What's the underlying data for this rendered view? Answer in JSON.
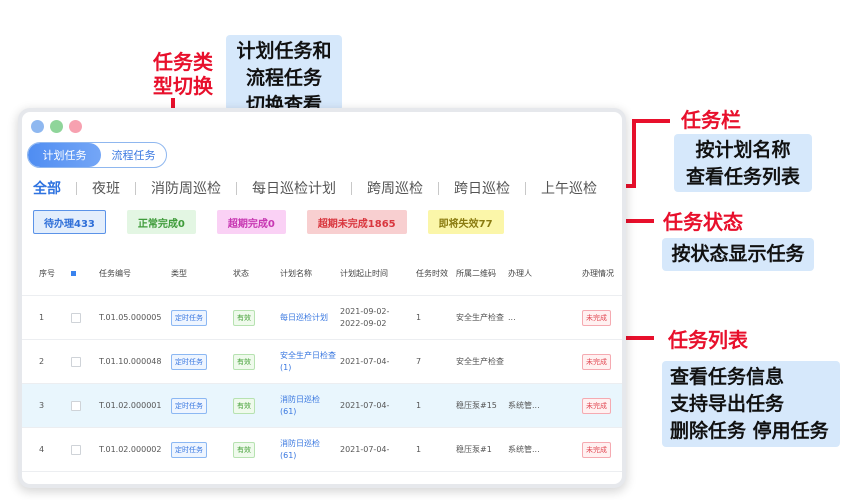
{
  "annotations": {
    "task_type": {
      "title": "任务类型切换",
      "note_lines": [
        "计划任务和",
        "流程任务",
        "切换查看"
      ]
    },
    "task_bar": {
      "title": "任务栏",
      "note_lines": [
        "按计划名称",
        "查看任务列表"
      ]
    },
    "task_status": {
      "title": "任务状态",
      "note_lines": [
        "按状态显示任务"
      ]
    },
    "task_list": {
      "title": "任务列表",
      "note_lines": [
        "查看任务信息",
        "支持导出任务",
        "删除任务 停用任务"
      ]
    }
  },
  "window": {
    "dot_colors": [
      "#8fb8f0",
      "#8fd59a",
      "#f7a1b0"
    ],
    "segment": {
      "active": "计划任务",
      "inactive": "流程任务"
    },
    "plan_tabs": [
      "全部",
      "夜班",
      "消防周巡检",
      "每日巡检计划",
      "跨周巡检",
      "跨日巡检",
      "上午巡检"
    ],
    "status_badges": [
      {
        "label": "待办理433",
        "bg": "#e3eefc",
        "color": "#2f6fd8",
        "border": "#5b93e8"
      },
      {
        "label": "正常完成0",
        "bg": "#e3f6e3",
        "color": "#3f9b3a",
        "border": "#e3f6e3"
      },
      {
        "label": "超期完成0",
        "bg": "#fad1f5",
        "color": "#c737b2",
        "border": "#fad1f5"
      },
      {
        "label": "超期未完成1865",
        "bg": "#f8cfd0",
        "color": "#d9363e",
        "border": "#f8cfd0"
      },
      {
        "label": "即将失效77",
        "bg": "#fbf6a9",
        "color": "#8a7b10",
        "border": "#fbf6a9"
      }
    ],
    "table": {
      "columns": [
        "序号",
        "",
        "任务编号",
        "类型",
        "状态",
        "计划名称",
        "计划起止时间",
        "任务时效",
        "所属二维码",
        "办理人",
        "办理情况"
      ],
      "rows": [
        {
          "no": "1",
          "code": "T.01.05.000005",
          "type": "定时任务",
          "state": "有效",
          "plan": "每日巡检计划",
          "time": "2021-09-02-2022-09-02",
          "validity": "1",
          "qr": "安全生产检查",
          "handler": "...",
          "result": "未完成"
        },
        {
          "no": "2",
          "code": "T.01.10.000048",
          "type": "定时任务",
          "state": "有效",
          "plan": "安全生产日检查(1)",
          "time": "2021-07-04-",
          "validity": "7",
          "qr": "安全生产检查",
          "handler": "",
          "result": "未完成"
        },
        {
          "no": "3",
          "code": "T.01.02.000001",
          "type": "定时任务",
          "state": "有效",
          "plan": "消防日巡检(61)",
          "time": "2021-07-04-",
          "validity": "1",
          "qr": "稳压泵#15",
          "handler": "系统管...",
          "result": "未完成"
        },
        {
          "no": "4",
          "code": "T.01.02.000002",
          "type": "定时任务",
          "state": "有效",
          "plan": "消防日巡检(61)",
          "time": "2021-07-04-",
          "validity": "1",
          "qr": "稳压泵#1",
          "handler": "系统管...",
          "result": "未完成"
        }
      ]
    }
  }
}
